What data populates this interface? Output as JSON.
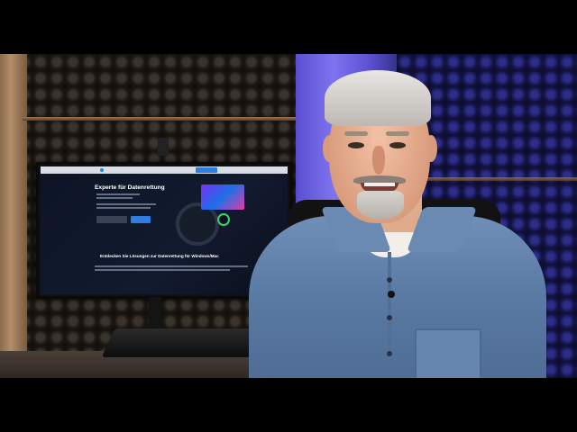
{
  "frame": {
    "letterbox_color": "#000000"
  },
  "scene": {
    "description_tags": [
      "studio",
      "acoustic-foam",
      "monitor",
      "presenter"
    ],
    "accent_colors": {
      "back_light": "#6a5fe0",
      "shirt": "#6f8fb8",
      "monitor_cta": "#2f7de0"
    }
  },
  "monitor": {
    "headline": "Experte für Datenrettung",
    "subheadline": "Entdecken Sie Lösungen zur Datenrettung für Windows/Mac"
  }
}
